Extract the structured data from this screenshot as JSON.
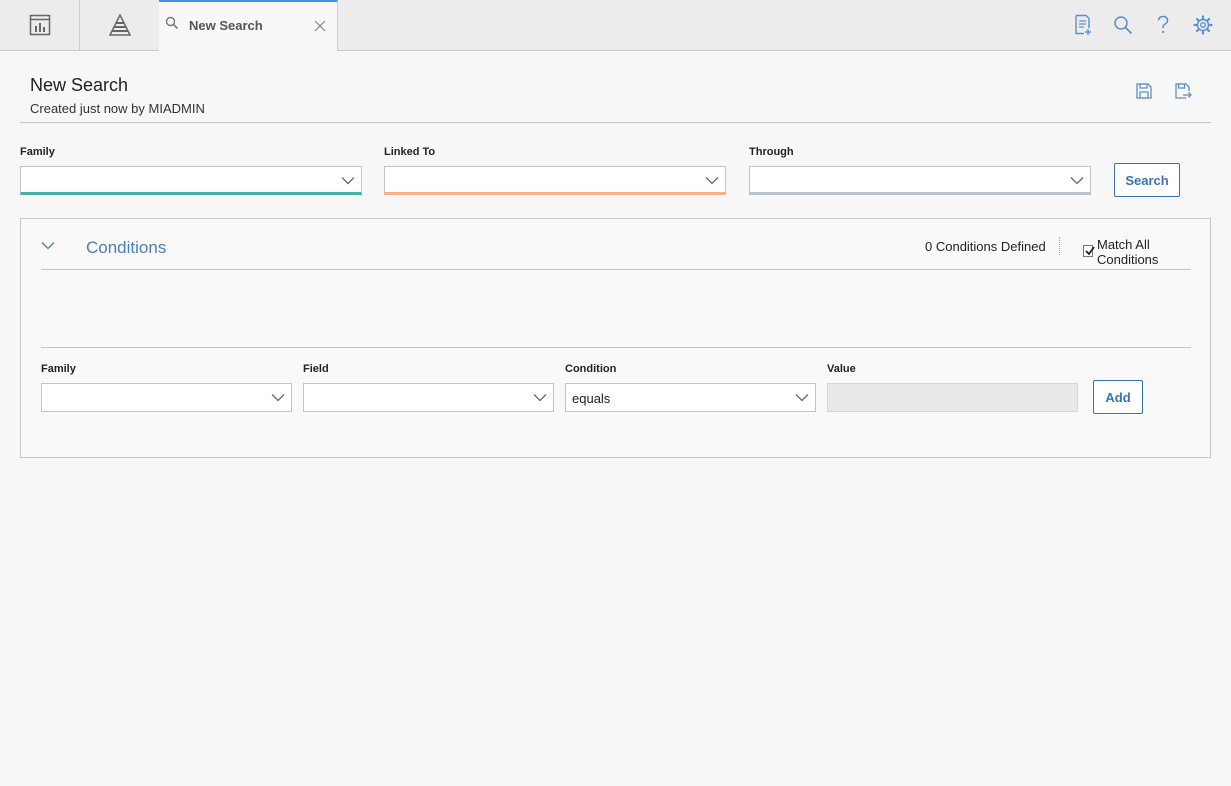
{
  "topbar": {
    "icons": [
      "dashboard-icon",
      "pyramid-icon"
    ],
    "tab": {
      "label": "New Search",
      "icon": "search-icon",
      "close_icon": "close-icon",
      "active_color": "#4a90e2"
    },
    "actions": [
      "new-document-icon",
      "search-icon",
      "help-icon",
      "settings-icon"
    ]
  },
  "header": {
    "title": "New Search",
    "subtitle": "Created just now by MIADMIN",
    "actions": [
      "save-icon",
      "save-as-icon"
    ]
  },
  "criteria": {
    "family_label": "Family",
    "linked_to_label": "Linked To",
    "through_label": "Through",
    "search_label": "Search",
    "family_color": "#48b3a4",
    "linked_to_color": "#f0b487",
    "through_color": "#b9c4cc"
  },
  "conditions": {
    "title": "Conditions",
    "count_text": "0 Conditions Defined",
    "match_all_label": "Match All Conditions",
    "match_all_checked": true,
    "family_label": "Family",
    "field_label": "Field",
    "condition_label": "Condition",
    "value_label": "Value",
    "condition_value": "equals",
    "add_label": "Add"
  },
  "colors": {
    "accent": "#3b73b9",
    "link": "#4a7fc1",
    "background": "#f7f7f7"
  }
}
